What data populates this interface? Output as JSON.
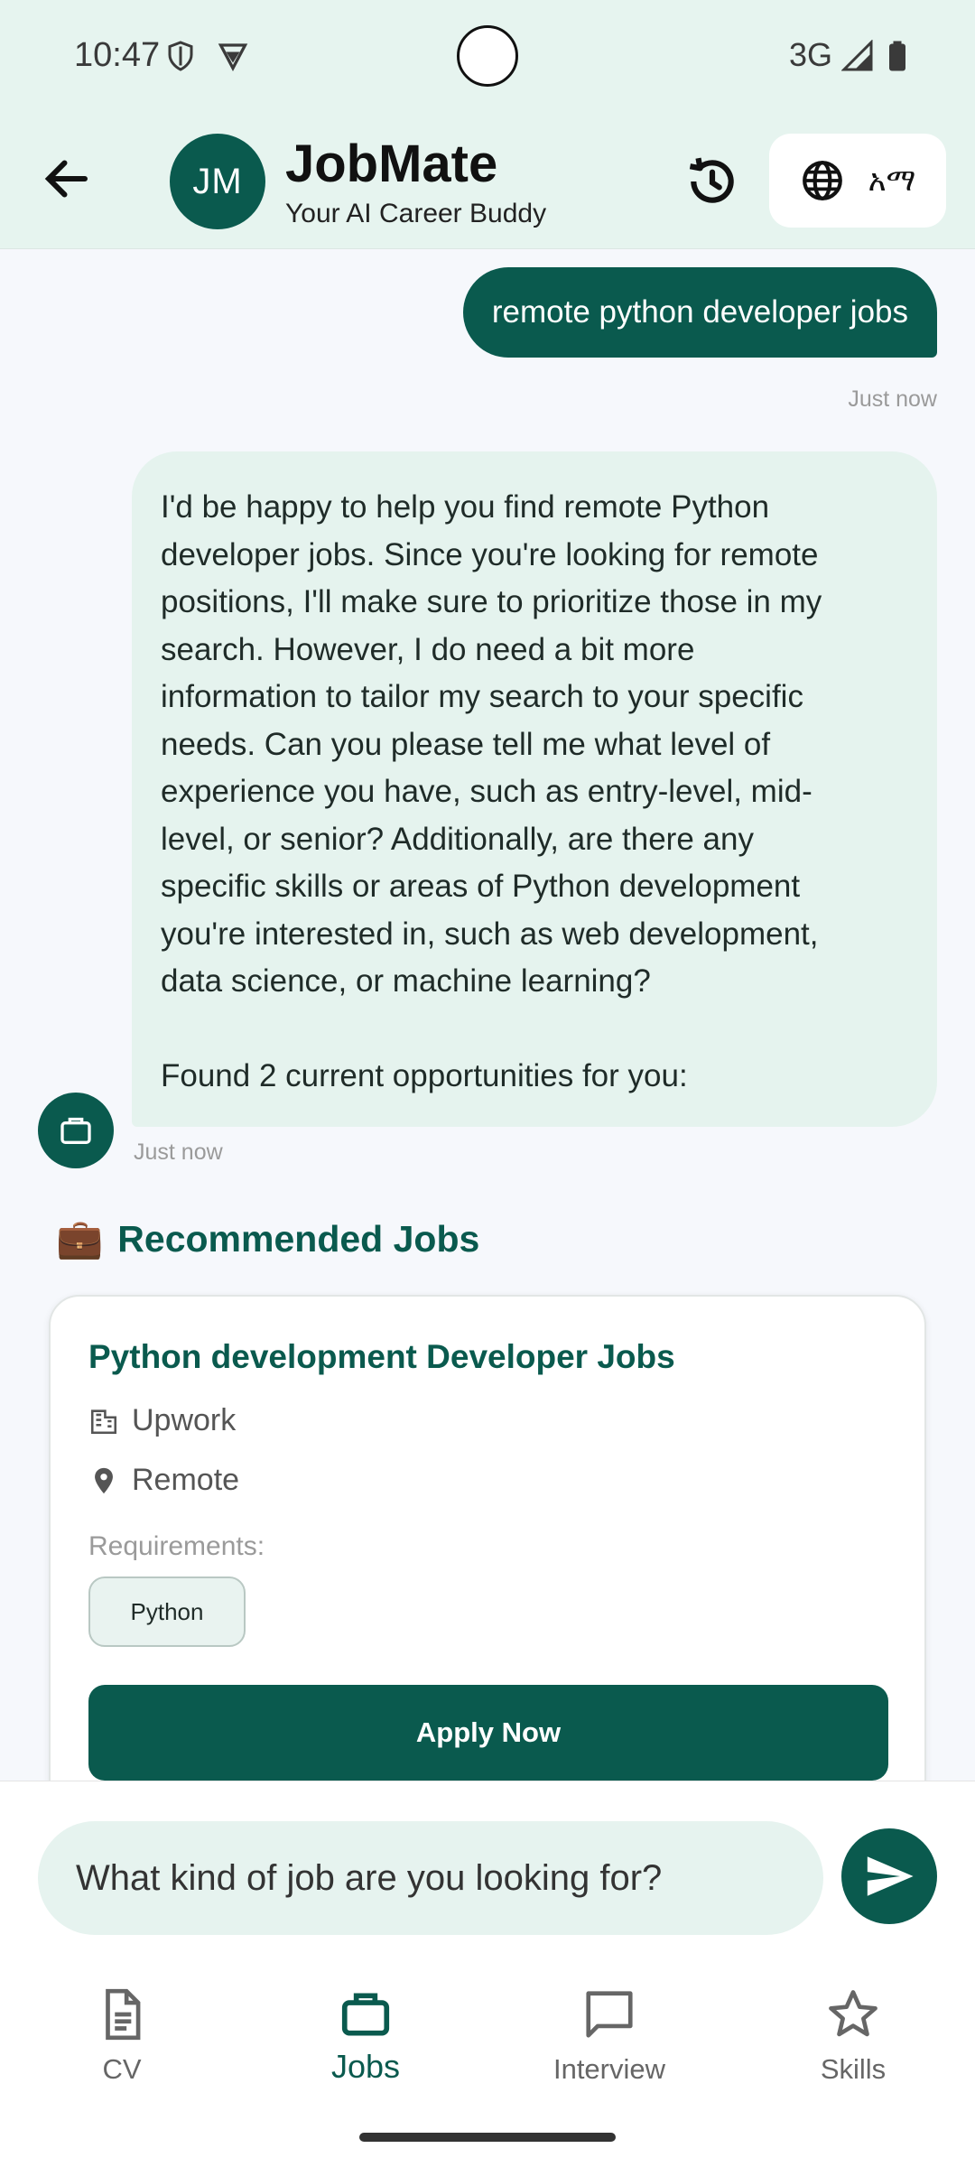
{
  "status_bar": {
    "time": "10:47",
    "network": "3G"
  },
  "header": {
    "avatar_initials": "JM",
    "title": "JobMate",
    "subtitle": "Your AI Career Buddy",
    "language_label": "አማ"
  },
  "chat": {
    "user_message": "remote python developer jobs",
    "user_timestamp": "Just now",
    "bot_message_lines": [
      "I'd be happy to help you find remote Python",
      "developer jobs. Since you're looking for remote",
      "positions, I'll make sure to prioritize those in my",
      "search. However, I do need a bit more",
      "information to tailor my search to your specific",
      "needs. Can you please tell me what level of",
      "experience you have, such as entry-level, mid-",
      "level, or senior? Additionally, are there any",
      "specific skills or areas of Python development",
      "you're interested in, such as web development,",
      "data science, or machine learning?"
    ],
    "bot_found_text": "Found 2 current opportunities for you:",
    "bot_timestamp": "Just now"
  },
  "recommended": {
    "heading_icon": "💼",
    "heading": "Recommended Jobs",
    "jobs": [
      {
        "title": "Python development Developer Jobs",
        "company": "Upwork",
        "location": "Remote",
        "requirements_label": "Requirements:",
        "requirements": [
          "Python"
        ],
        "apply_label": "Apply Now"
      }
    ]
  },
  "composer": {
    "placeholder": "What kind of job are you looking for?"
  },
  "nav": {
    "items": [
      {
        "label": "CV",
        "icon": "document-icon"
      },
      {
        "label": "Jobs",
        "icon": "briefcase-icon",
        "active": true
      },
      {
        "label": "Interview",
        "icon": "chat-icon"
      },
      {
        "label": "Skills",
        "icon": "star-icon"
      }
    ]
  },
  "colors": {
    "primary": "#0a5a4e",
    "header_bg": "#e6f4ef",
    "bubble_bg": "#e5f3ee"
  }
}
